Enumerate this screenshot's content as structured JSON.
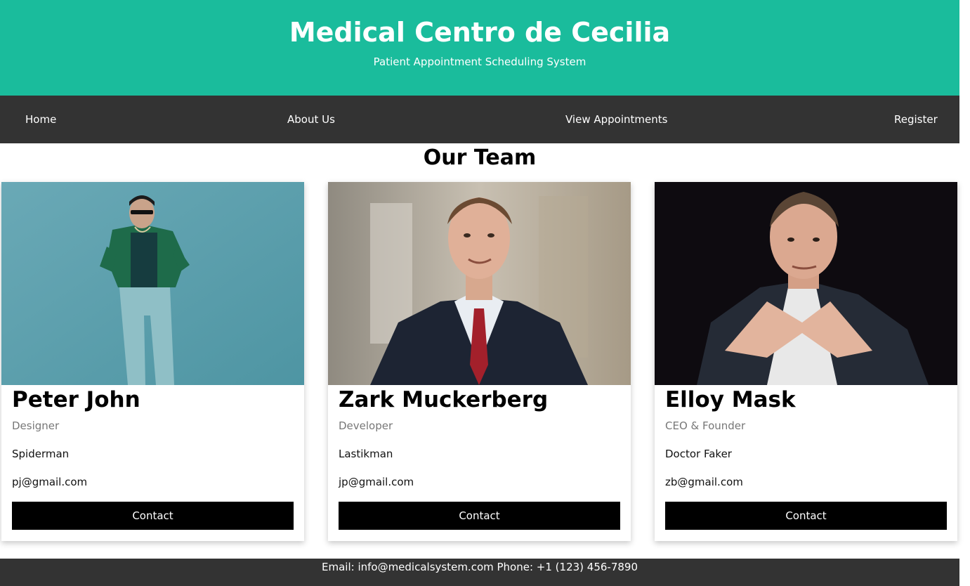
{
  "header": {
    "title": "Medical Centro de Cecilia",
    "subtitle": "Patient Appointment Scheduling System"
  },
  "nav": {
    "items": [
      {
        "label": "Home"
      },
      {
        "label": "About Us"
      },
      {
        "label": "View Appointments"
      },
      {
        "label": "Register"
      }
    ]
  },
  "main": {
    "section_title": "Our Team",
    "team": [
      {
        "name": "Peter John",
        "role": "Designer",
        "alias": "Spiderman",
        "email": "pj@gmail.com",
        "button_label": "Contact"
      },
      {
        "name": "Zark Muckerberg",
        "role": "Developer",
        "alias": "Lastikman",
        "email": "jp@gmail.com",
        "button_label": "Contact"
      },
      {
        "name": "Elloy Mask",
        "role": "CEO & Founder",
        "alias": "Doctor Faker",
        "email": "zb@gmail.com",
        "button_label": "Contact"
      }
    ]
  },
  "footer": {
    "text": "Email: info@medicalsystem.com Phone: +1 (123) 456-7890"
  },
  "colors": {
    "header_bg": "#1abc9c",
    "nav_bg": "#333333",
    "footer_bg": "#333333",
    "button_bg": "#000000",
    "role_text": "#777777"
  }
}
